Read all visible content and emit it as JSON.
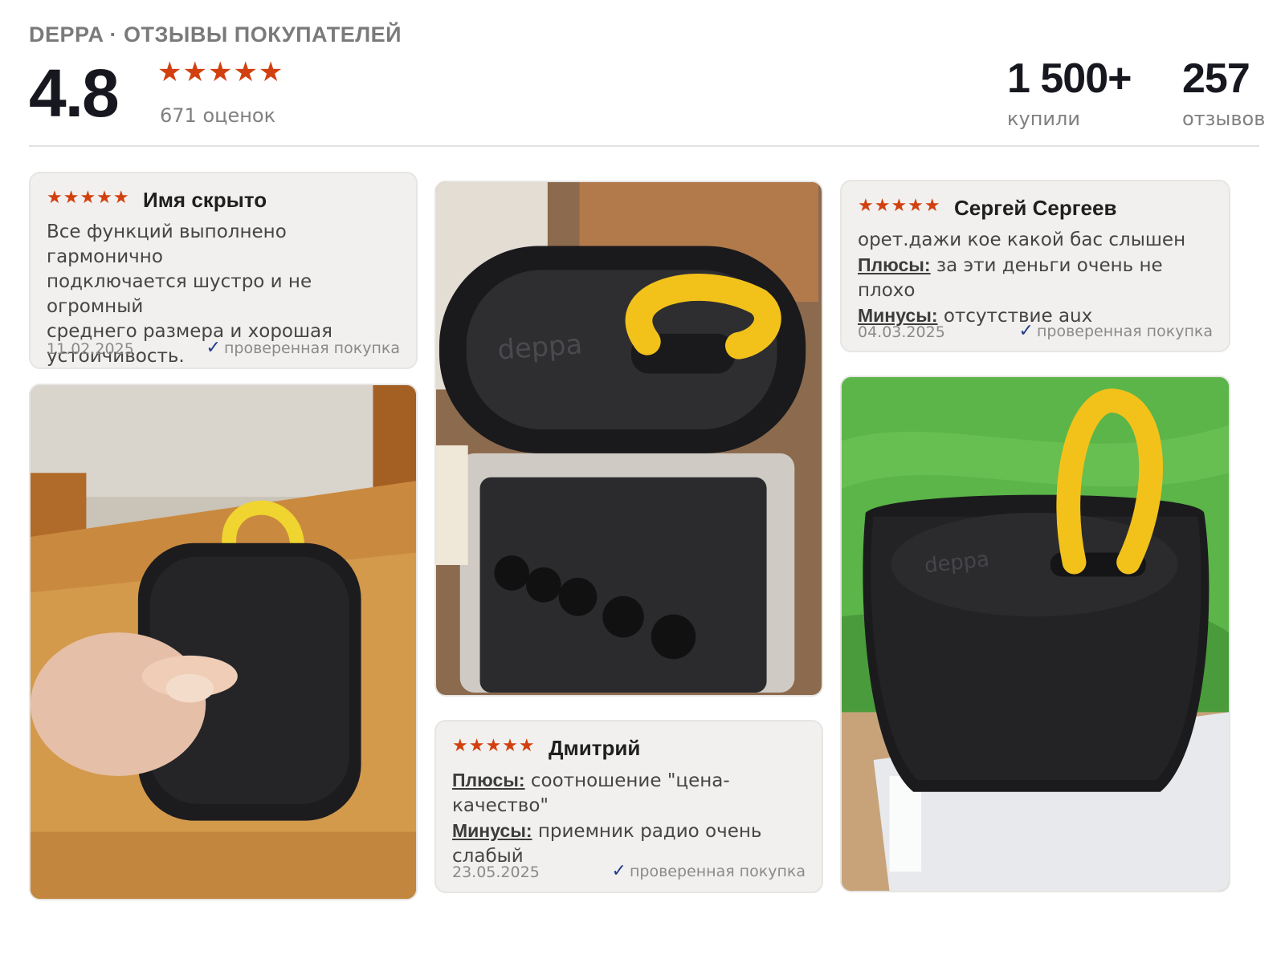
{
  "header": {
    "brand": "DEPPA · ОТЗЫВЫ ПОКУПАТЕЛЕЙ",
    "rating": "4.8",
    "stars": "★★★★★",
    "ratings_count": "671 оценок",
    "bought_value": "1 500+",
    "bought_label": "купили",
    "reviews_value": "257",
    "reviews_label": "отзывов"
  },
  "reviews": [
    {
      "stars": "★★★★★",
      "author": "Имя скрыто",
      "text_lines": [
        "Все функций выполнено гармонично",
        "подключается шустро и не огромный",
        "среднего размера и хорошая",
        "устоичивость."
      ],
      "date": "11.02.2025",
      "verified": "проверенная покупка"
    },
    {
      "stars": "★★★★★",
      "author": "Дмитрий",
      "pros_label": "Плюсы:",
      "pros": "соотношение \"цена-качество\"",
      "cons_label": "Минусы:",
      "cons_line1": "приемник радио очень",
      "cons_line2": "слабый",
      "date": "23.05.2025",
      "verified": "проверенная покупка"
    },
    {
      "stars": "★★★★★",
      "author": "Сергей Сергеев",
      "comment": "орет.дажи кое какой бас слышен",
      "pros_label": "Плюсы:",
      "pros": "за эти деньги очень не плохо",
      "cons_label": "Минусы:",
      "cons": "отсутствие aux",
      "date": "04.03.2025",
      "verified": "проверенная покупка"
    }
  ],
  "photos": {
    "logo_text": "deppa"
  },
  "colors": {
    "star": "#d2400f",
    "check": "#1f3c88",
    "card_bg": "#f1f0ee",
    "strap_yellow": "#f2c21b",
    "speaker_black": "#1b1b1d"
  }
}
